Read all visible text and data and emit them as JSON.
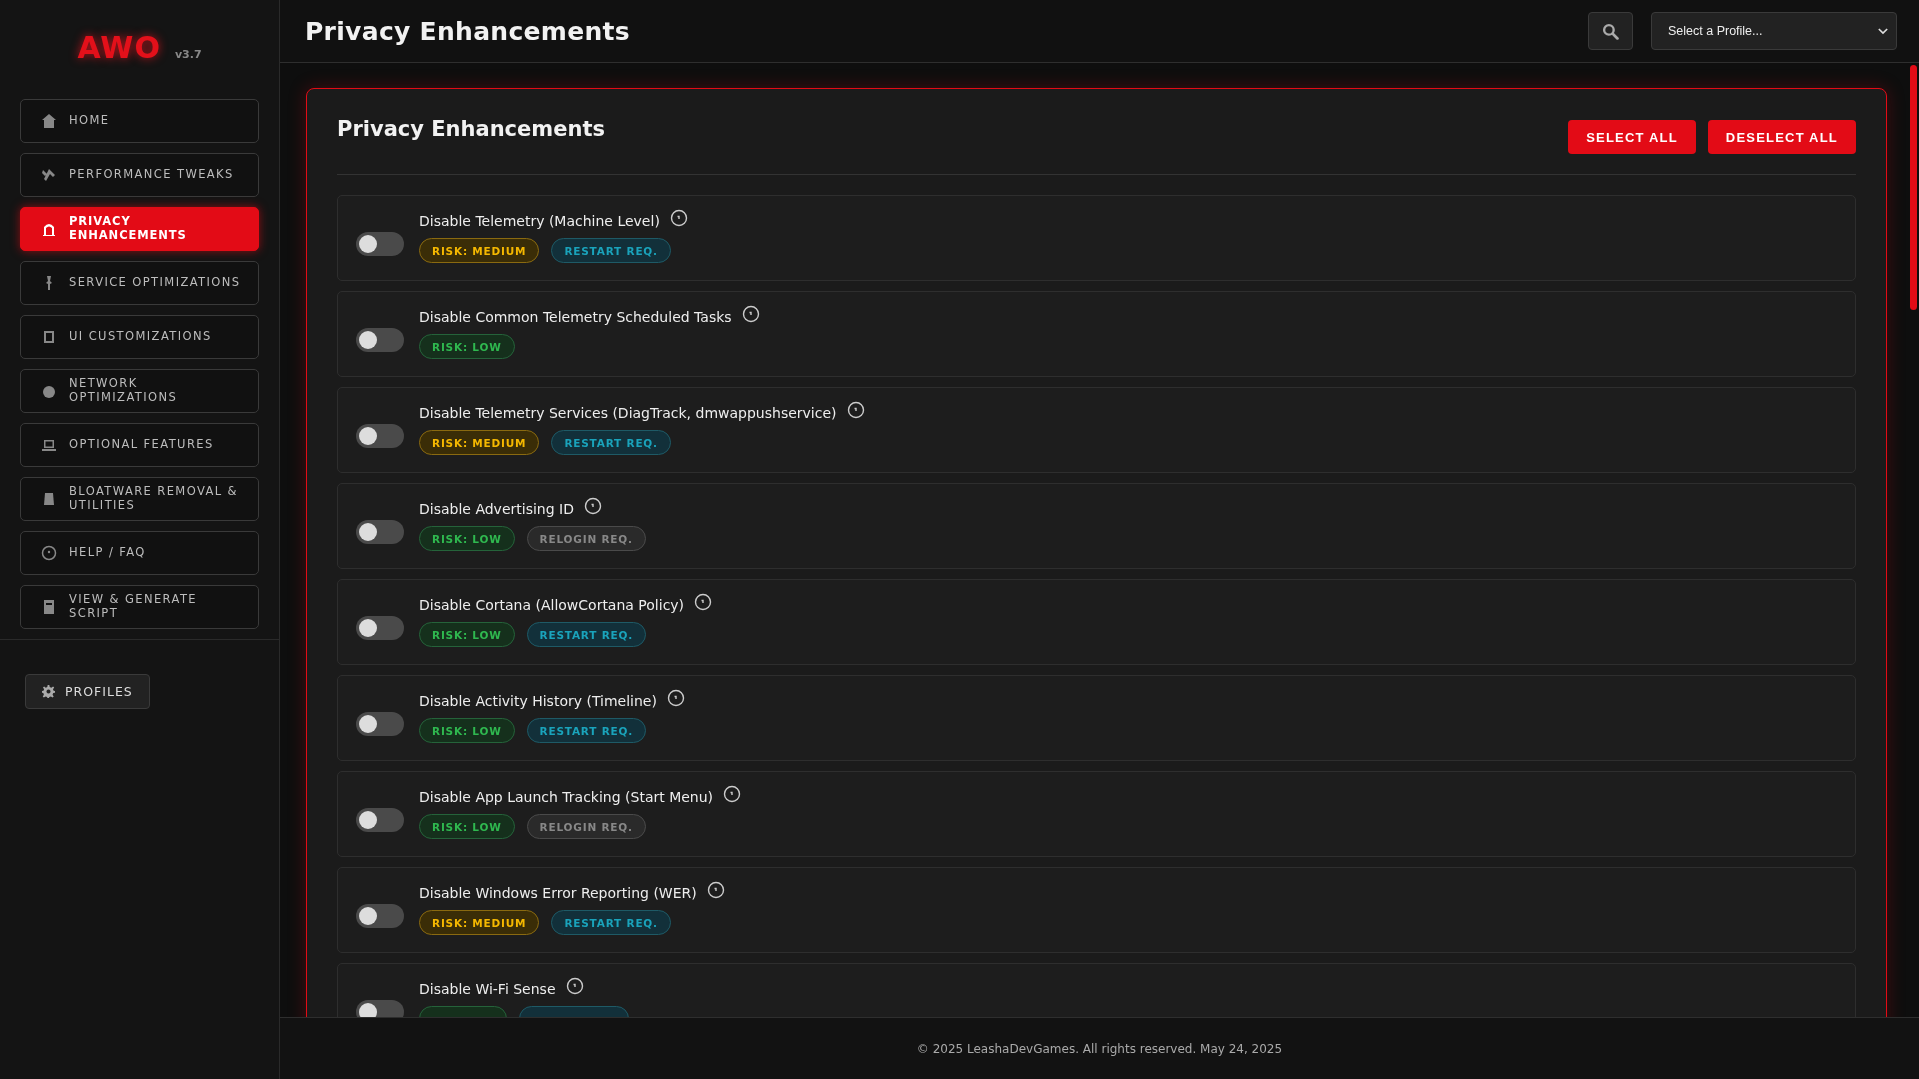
{
  "sidebar": {
    "logo": "AWO",
    "version": "v3.7",
    "items": [
      {
        "label": "HOME",
        "selected": false
      },
      {
        "label": "PERFORMANCE TWEAKS",
        "selected": false
      },
      {
        "label": "PRIVACY ENHANCEMENTS",
        "selected": true
      },
      {
        "label": "SERVICE OPTIMIZATIONS",
        "selected": false
      },
      {
        "label": "UI CUSTOMIZATIONS",
        "selected": false
      },
      {
        "label": "NETWORK OPTIMIZATIONS",
        "selected": false
      },
      {
        "label": "OPTIONAL FEATURES",
        "selected": false
      },
      {
        "label": "BLOATWARE REMOVAL & UTILITIES",
        "selected": false
      },
      {
        "label": "HELP / FAQ",
        "selected": false
      },
      {
        "label": "VIEW & GENERATE SCRIPT",
        "selected": false
      }
    ],
    "profiles_button": "PROFILES"
  },
  "header": {
    "title": "Privacy Enhancements",
    "profile_select": {
      "value": "Select a Profile..."
    }
  },
  "section": {
    "title": "Privacy Enhancements",
    "buttons": [
      "SELECT ALL",
      "DESELECT ALL"
    ],
    "tweaks": [
      {
        "label": "Disable Telemetry (Machine Level)",
        "on": false,
        "tags": [
          {
            "kind": "medium",
            "label": "RISK: MEDIUM"
          },
          {
            "kind": "restart",
            "label": "RESTART REQ."
          }
        ]
      },
      {
        "label": "Disable Common Telemetry Scheduled Tasks",
        "on": false,
        "tags": [
          {
            "kind": "low",
            "label": "RISK: LOW"
          }
        ]
      },
      {
        "label": "Disable Telemetry Services (DiagTrack, dmwappushservice)",
        "on": false,
        "tags": [
          {
            "kind": "medium",
            "label": "RISK: MEDIUM"
          },
          {
            "kind": "restart",
            "label": "RESTART REQ."
          }
        ]
      },
      {
        "label": "Disable Advertising ID",
        "on": false,
        "tags": [
          {
            "kind": "low",
            "label": "RISK: LOW"
          },
          {
            "kind": "relogin",
            "label": "RELOGIN REQ."
          }
        ]
      },
      {
        "label": "Disable Cortana (AllowCortana Policy)",
        "on": false,
        "tags": [
          {
            "kind": "low",
            "label": "RISK: LOW"
          },
          {
            "kind": "restart",
            "label": "RESTART REQ."
          }
        ]
      },
      {
        "label": "Disable Activity History (Timeline)",
        "on": false,
        "tags": [
          {
            "kind": "low",
            "label": "RISK: LOW"
          },
          {
            "kind": "restart",
            "label": "RESTART REQ."
          }
        ]
      },
      {
        "label": "Disable App Launch Tracking (Start Menu)",
        "on": false,
        "tags": [
          {
            "kind": "low",
            "label": "RISK: LOW"
          },
          {
            "kind": "relogin",
            "label": "RELOGIN REQ."
          }
        ]
      },
      {
        "label": "Disable Windows Error Reporting (WER)",
        "on": false,
        "tags": [
          {
            "kind": "medium",
            "label": "RISK: MEDIUM"
          },
          {
            "kind": "restart",
            "label": "RESTART REQ."
          }
        ]
      },
      {
        "label": "Disable Wi-Fi Sense",
        "on": false,
        "tags": [
          {
            "kind": "low"
          },
          {
            "kind": "restart"
          }
        ]
      }
    ]
  },
  "footer": "© 2025 LeashaDevGames. All rights reserved. May 24, 2025"
}
